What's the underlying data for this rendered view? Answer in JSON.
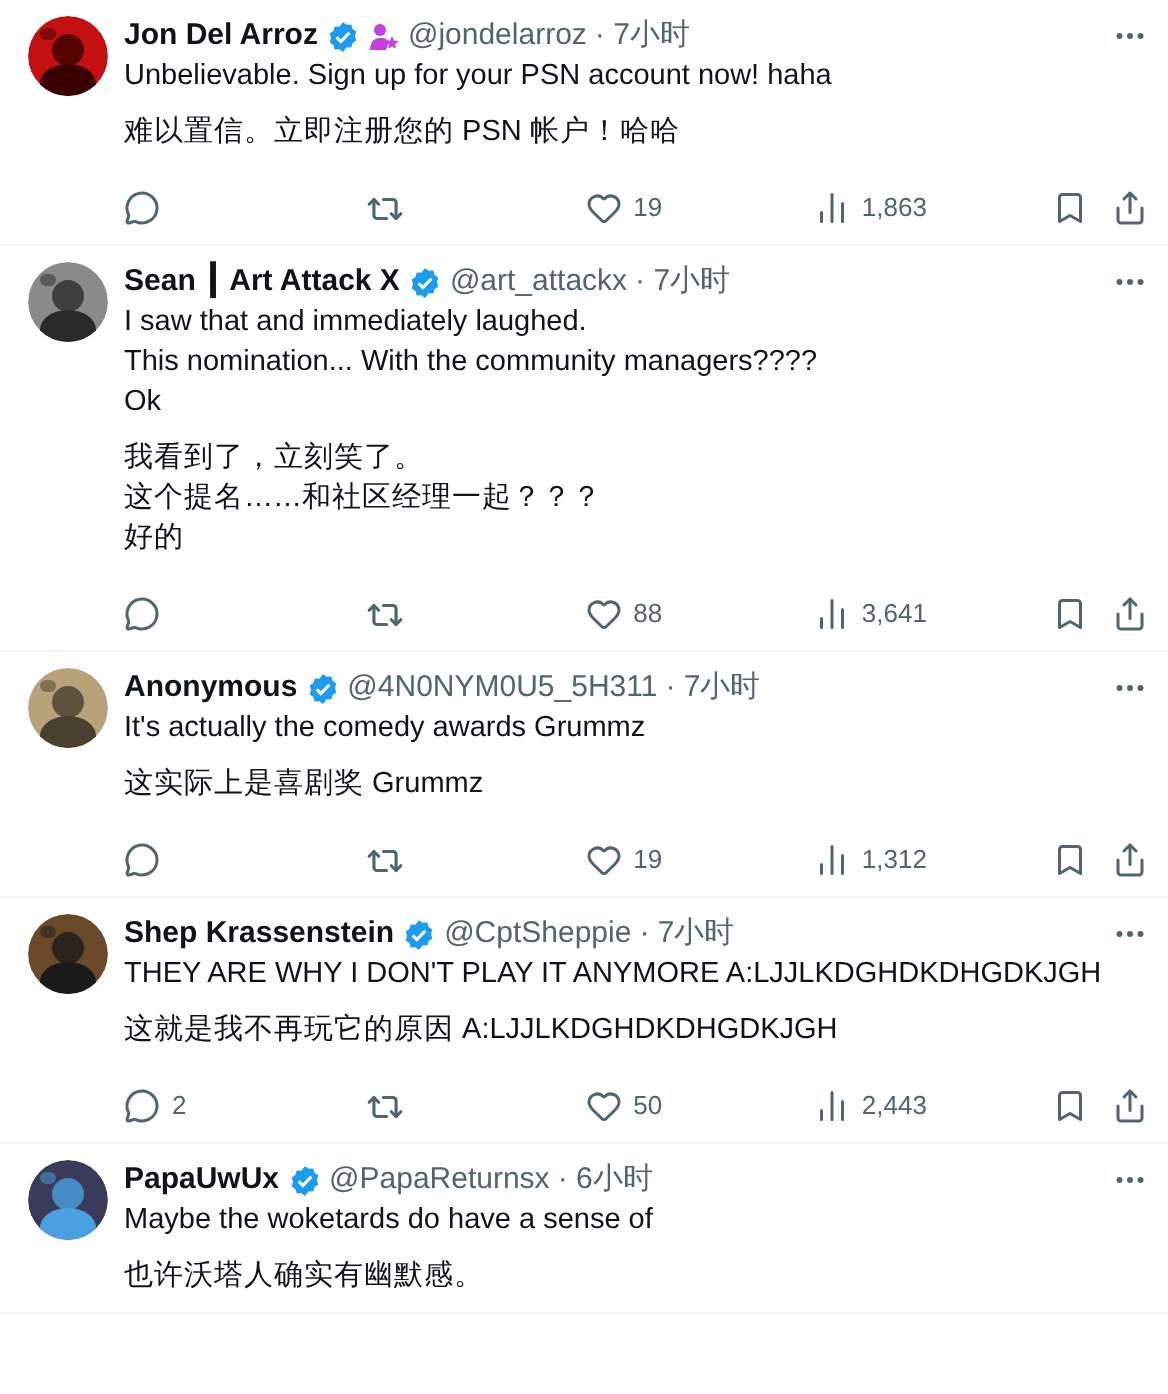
{
  "tweets": [
    {
      "name": "Jon Del Arroz",
      "verified": true,
      "affiliate": true,
      "handle": "@jondelarroz",
      "time": "· 7小时",
      "paragraphs": [
        [
          "Unbelievable.  Sign up for your PSN account now! haha"
        ],
        [
          "难以置信。立即注册您的 PSN 帐户！哈哈"
        ]
      ],
      "actions": {
        "likes": "19",
        "views": "1,863"
      }
    },
    {
      "name": "Sean ┃ Art Attack X",
      "verified": true,
      "affiliate": false,
      "handle": "@art_attackx",
      "time": "· 7小时",
      "paragraphs": [
        [
          "I saw that and immediately laughed.",
          "This nomination... With the community managers????",
          "Ok"
        ],
        [
          "我看到了，立刻笑了。",
          "这个提名……和社区经理一起？？？",
          "好的"
        ]
      ],
      "actions": {
        "likes": "88",
        "views": "3,641"
      }
    },
    {
      "name": "Anonymous",
      "verified": true,
      "affiliate": false,
      "handle": "@4N0NYM0U5_5H311",
      "time": "· 7小时",
      "paragraphs": [
        [
          "It's actually the comedy awards Grummz"
        ],
        [
          "这实际上是喜剧奖 Grummz"
        ]
      ],
      "actions": {
        "likes": "19",
        "views": "1,312"
      }
    },
    {
      "name": "Shep Krassenstein",
      "verified": true,
      "affiliate": false,
      "handle": "@CptSheppie",
      "time": "· 7小时",
      "paragraphs": [
        [
          "THEY ARE WHY I DON'T PLAY IT ANYMORE A:LJJLKDGHDKDHGDKJGH"
        ],
        [
          "这就是我不再玩它的原因 A:LJJLKDGHDKDHGDKJGH"
        ]
      ],
      "actions": {
        "replies": "2",
        "likes": "50",
        "views": "2,443"
      }
    },
    {
      "name": "PapaUwUx",
      "verified": true,
      "affiliate": false,
      "handle": "@PapaReturnsx",
      "time": "· 6小时",
      "paragraphs": [
        [
          "Maybe the woketards do have a sense of"
        ],
        [
          "也许沃塔人确实有幽默感。"
        ]
      ]
    }
  ]
}
